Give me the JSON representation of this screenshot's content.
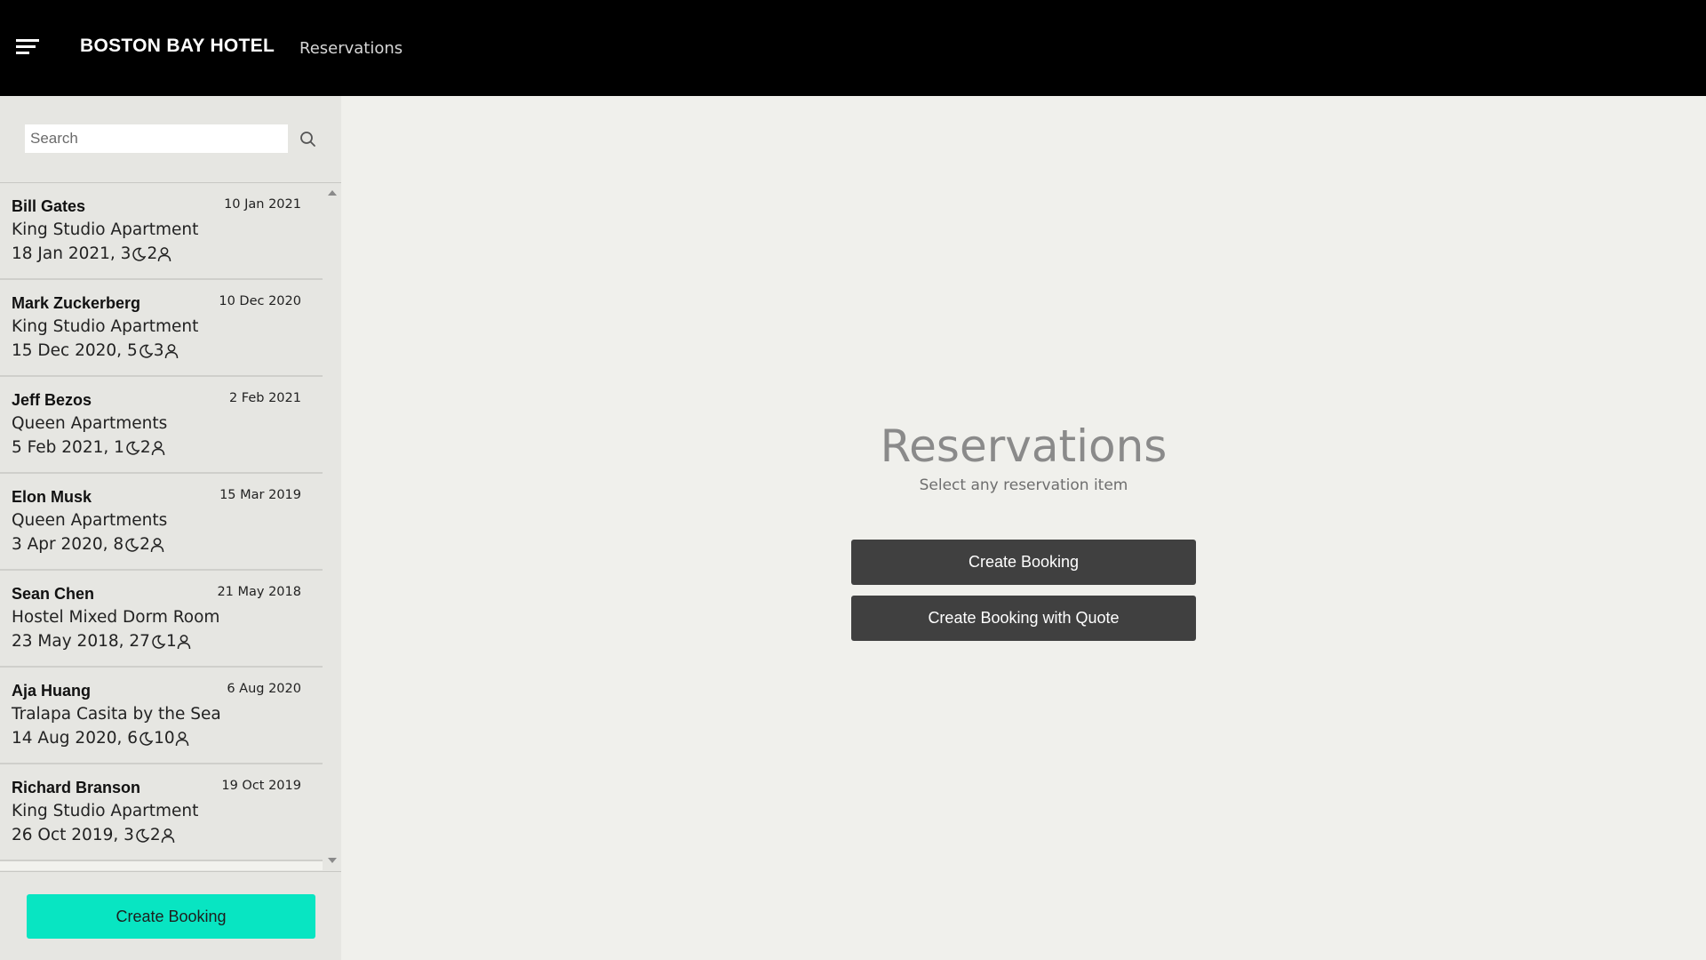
{
  "header": {
    "brand": "BOSTON BAY HOTEL",
    "section": "Reservations"
  },
  "sidebar": {
    "search_placeholder": "Search",
    "reservations": [
      {
        "guest": "Bill Gates",
        "booked": "10 Jan 2021",
        "room": "King Studio Apartment",
        "arrival": "18 Jan 2021,",
        "nights": "3",
        "guests": "2"
      },
      {
        "guest": "Mark Zuckerberg",
        "booked": "10 Dec 2020",
        "room": "King Studio Apartment",
        "arrival": "15 Dec 2020,",
        "nights": "5",
        "guests": "3"
      },
      {
        "guest": "Jeff Bezos",
        "booked": "2 Feb 2021",
        "room": "Queen Apartments",
        "arrival": "5 Feb 2021,",
        "nights": "1",
        "guests": "2"
      },
      {
        "guest": "Elon Musk",
        "booked": "15 Mar 2019",
        "room": "Queen Apartments",
        "arrival": "3 Apr 2020,",
        "nights": "8",
        "guests": "2"
      },
      {
        "guest": "Sean Chen",
        "booked": "21 May 2018",
        "room": "Hostel Mixed Dorm Room",
        "arrival": "23 May 2018,",
        "nights": "27",
        "guests": "1"
      },
      {
        "guest": "Aja Huang",
        "booked": "6 Aug 2020",
        "room": "Tralapa Casita by the Sea",
        "arrival": "14 Aug 2020,",
        "nights": "6",
        "guests": "10"
      },
      {
        "guest": "Richard Branson",
        "booked": "19 Oct 2019",
        "room": "King Studio Apartment",
        "arrival": "26 Oct 2019,",
        "nights": "3",
        "guests": "2"
      }
    ],
    "create_label": "Create Booking"
  },
  "main": {
    "title": "Reservations",
    "subtitle": "Select any reservation item",
    "create_label": "Create Booking",
    "create_quote_label": "Create Booking with Quote"
  },
  "colors": {
    "topbar": "#000000",
    "sidebar_bg": "#e6e6e2",
    "main_bg": "#f0f0ec",
    "accent": "#08e5c2",
    "dark_button": "#404040"
  },
  "icons": {
    "menu": "menu-icon",
    "search": "search-icon",
    "nights": "moon-icon",
    "guests": "person-icon"
  }
}
